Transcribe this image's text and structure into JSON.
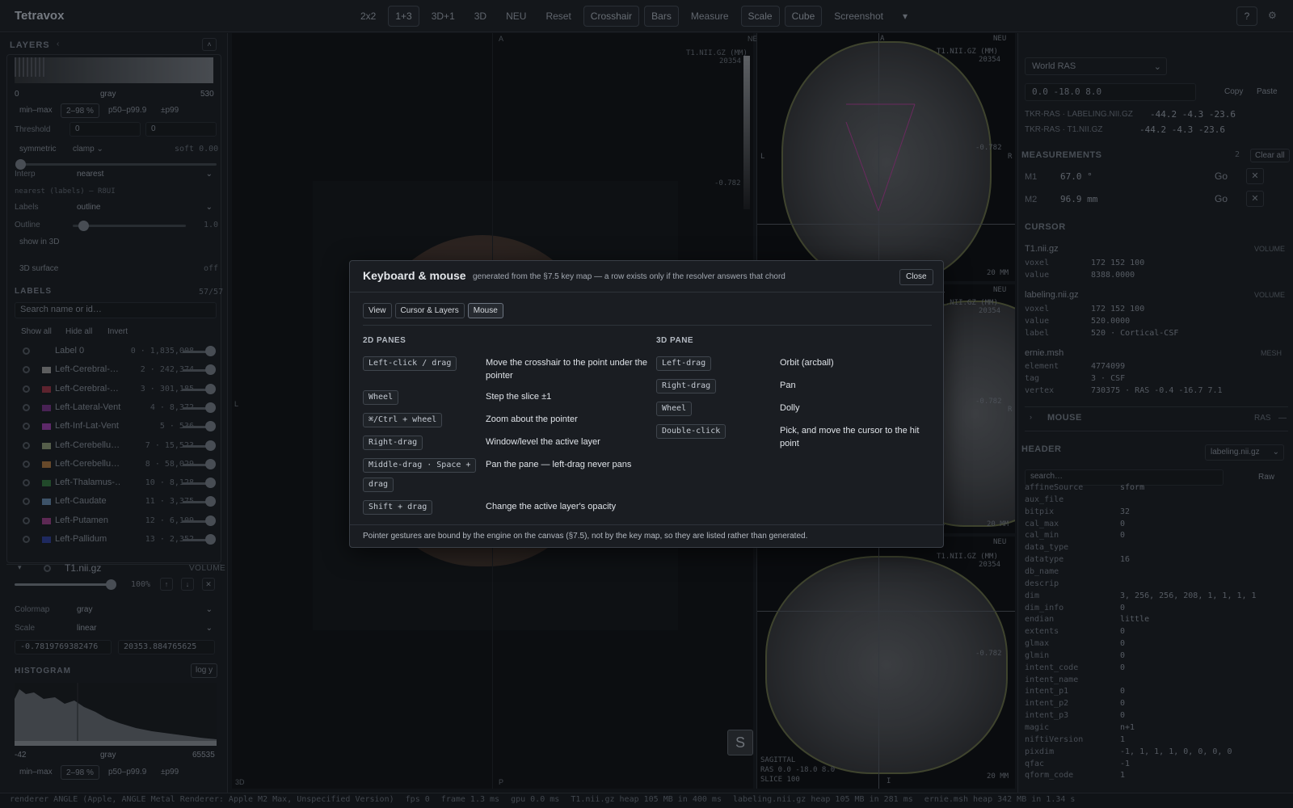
{
  "app": {
    "title": "Tetravox",
    "modes": [
      "2x2",
      "1+3",
      "3D+1",
      "3D",
      "NEU",
      "Reset",
      "Crosshair",
      "Bars",
      "Measure",
      "Scale",
      "Cube",
      "Screenshot"
    ],
    "help": "?"
  },
  "left": {
    "layers_title": "LAYERS",
    "hist_min": "0",
    "hist_cmap": "gray",
    "hist_max": "530",
    "range_chips": [
      "min–max",
      "2–98 %",
      "p50–p99.9",
      "±p99"
    ],
    "threshold_label": "Threshold",
    "threshold_lo": "0",
    "threshold_hi": "0",
    "symmetric": "symmetric",
    "clamp": "clamp",
    "soft": "soft 0.00",
    "interp_label": "Interp",
    "interp_value": "nearest",
    "interp_note": "nearest (labels) — R8UI",
    "labels_label": "Labels",
    "labels_value": "outline",
    "outline_label": "Outline",
    "outline_value": "1.0",
    "show3d": "show in 3D",
    "surface": "3D surface",
    "surface_state": "off",
    "labels_section": "LABELS",
    "labels_count": "57/57",
    "search_placeholder": "Search name or id…",
    "show_all": "Show all",
    "hide_all": "Hide all",
    "invert": "Invert",
    "labels": [
      {
        "name": "Label 0",
        "count": "0 · 1,835,008",
        "color": ""
      },
      {
        "name": "Left-Cerebral-…",
        "count": "2 · 242,374",
        "color": "#8a8a8a"
      },
      {
        "name": "Left-Cerebral-…",
        "count": "3 · 301,185",
        "color": "#8a3040"
      },
      {
        "name": "Left-Lateral-Vent…",
        "count": "4 · 8,372",
        "color": "#6a2e7a"
      },
      {
        "name": "Left-Inf-Lat-Vent",
        "count": "5 · 536",
        "color": "#8a3a9a"
      },
      {
        "name": "Left-Cerebellu…",
        "count": "7 · 15,523",
        "color": "#7f8a6a"
      },
      {
        "name": "Left-Cerebellu…",
        "count": "8 · 58,029",
        "color": "#9a6a3a"
      },
      {
        "name": "Left-Thalamus-…",
        "count": "10 · 8,128",
        "color": "#2e6a3a"
      },
      {
        "name": "Left-Caudate",
        "count": "11 · 3,375",
        "color": "#5a7a9a"
      },
      {
        "name": "Left-Putamen",
        "count": "12 · 6,109",
        "color": "#8a3a7a"
      },
      {
        "name": "Left-Pallidum",
        "count": "13 · 2,352",
        "color": "#2a3a8a"
      }
    ],
    "volume_name": "T1.nii.gz",
    "volume_kind": "VOLUME",
    "opacity": "100%",
    "colormap_label": "Colormap",
    "colormap_value": "gray",
    "scale_label": "Scale",
    "scale_value": "linear",
    "range_lo": "-0.7819769382476",
    "range_hi": "20353.884765625",
    "histogram_title": "HISTOGRAM",
    "log_y": "log y",
    "hist2_min": "-42",
    "hist2_cmap": "gray",
    "hist2_max": "65535",
    "range_chips2": [
      "min–max",
      "2–98 %",
      "p50–p99.9",
      "±p99"
    ]
  },
  "viewports": {
    "main_top": "A",
    "main_left": "L",
    "main_bottom": "P",
    "main_label": "3D",
    "neu": "NEU",
    "file_label": "T1.NII.GZ (MM)",
    "cbar_max": "20354",
    "cbar_min": "-0.782",
    "scale_bar": "20 MM",
    "pane_right": "R",
    "pane_left": "L",
    "pane_bottom": "I",
    "sagittal_label": "SAGITTAL",
    "sagittal_coord": "RAS 0.0 -18.0 8.0",
    "sagittal_slice": "SLICE 100",
    "hover_key": "S"
  },
  "right": {
    "space": "World RAS",
    "coord": "0.0 -18.0 8.0",
    "copy": "Copy",
    "paste": "Paste",
    "tkr1_label": "TKR-RAS · LABELING.NII.GZ",
    "tkr1_value": "-44.2 -4.3 -23.6",
    "tkr2_label": "TKR-RAS · T1.NII.GZ",
    "tkr2_value": "-44.2 -4.3 -23.6",
    "measurements": "MEASUREMENTS",
    "meas_count": "2",
    "clear_all": "Clear all",
    "meas": [
      {
        "id": "M1",
        "value": "67.0 °",
        "go": "Go"
      },
      {
        "id": "M2",
        "value": "96.9 mm",
        "go": "Go"
      }
    ],
    "cursor": "CURSOR",
    "c1_name": "T1.nii.gz",
    "c1_kind": "VOLUME",
    "c1_voxel_k": "voxel",
    "c1_voxel_v": "172 152 100",
    "c1_value_k": "value",
    "c1_value_v": "8388.0000",
    "c2_name": "labeling.nii.gz",
    "c2_kind": "VOLUME",
    "c2_voxel_k": "voxel",
    "c2_voxel_v": "172 152 100",
    "c2_value_k": "value",
    "c2_value_v": "520.0000",
    "c2_label_k": "label",
    "c2_label_v": "520 · Cortical-CSF",
    "c3_name": "ernie.msh",
    "c3_kind": "MESH",
    "c3_el_k": "element",
    "c3_el_v": "4774099",
    "c3_tag_k": "tag",
    "c3_tag_v": "3 · CSF",
    "c3_vx_k": "vertex",
    "c3_vx_v": "730375 · RAS -0.4 -16.7 7.1",
    "mouse": "MOUSE",
    "mouse_space": "RAS",
    "mouse_dash": "—",
    "header": "HEADER",
    "header_file": "labeling.nii.gz",
    "header_search": "search…",
    "raw": "Raw",
    "fields": [
      {
        "k": "affineSource",
        "v": "sform"
      },
      {
        "k": "aux_file",
        "v": ""
      },
      {
        "k": "bitpix",
        "v": "32"
      },
      {
        "k": "cal_max",
        "v": "0"
      },
      {
        "k": "cal_min",
        "v": "0"
      },
      {
        "k": "data_type",
        "v": ""
      },
      {
        "k": "datatype",
        "v": "16"
      },
      {
        "k": "db_name",
        "v": ""
      },
      {
        "k": "descrip",
        "v": ""
      },
      {
        "k": "dim",
        "v": "3, 256, 256, 208, 1, 1, 1, 1"
      },
      {
        "k": "dim_info",
        "v": "0"
      },
      {
        "k": "endian",
        "v": "little"
      },
      {
        "k": "extents",
        "v": "0"
      },
      {
        "k": "glmax",
        "v": "0"
      },
      {
        "k": "glmin",
        "v": "0"
      },
      {
        "k": "intent_code",
        "v": "0"
      },
      {
        "k": "intent_name",
        "v": ""
      },
      {
        "k": "intent_p1",
        "v": "0"
      },
      {
        "k": "intent_p2",
        "v": "0"
      },
      {
        "k": "intent_p3",
        "v": "0"
      },
      {
        "k": "magic",
        "v": "n+1"
      },
      {
        "k": "niftiVersion",
        "v": "1"
      },
      {
        "k": "pixdim",
        "v": "-1, 1, 1, 1, 0, 0, 0, 0"
      },
      {
        "k": "qfac",
        "v": "-1"
      },
      {
        "k": "qform_code",
        "v": "1"
      }
    ]
  },
  "status": {
    "renderer": "renderer ANGLE (Apple, ANGLE Metal Renderer: Apple M2 Max, Unspecified Version)",
    "fps": "fps 0",
    "frame": "frame 1.3 ms",
    "gpu": "gpu 0.0 ms",
    "t1": "T1.nii.gz heap 105 MB in 400 ms",
    "lab": "labeling.nii.gz heap 105 MB in 281 ms",
    "msh": "ernie.msh heap 342 MB in 1.34 s"
  },
  "modal": {
    "title": "Keyboard & mouse",
    "subtitle": "generated from the §7.5 key map — a row exists only if the resolver answers that chord",
    "close": "Close",
    "tabs": [
      "View",
      "Cursor & Layers",
      "Mouse"
    ],
    "col2d": "2D PANES",
    "col3d": "3D PANE",
    "rows2d": [
      {
        "key": "Left-click / drag",
        "desc": "Move the crosshair to the point under the pointer"
      },
      {
        "key": "Wheel",
        "desc": "Step the slice ±1"
      },
      {
        "key": "⌘/Ctrl + wheel",
        "desc": "Zoom about the pointer"
      },
      {
        "key": "Right-drag",
        "desc": "Window/level the active layer"
      },
      {
        "key": "Middle-drag · Space +",
        "key2": "drag",
        "desc": "Pan the pane — left-drag never pans"
      },
      {
        "key": "Shift + drag",
        "desc": "Change the active layer's opacity"
      }
    ],
    "rows3d": [
      {
        "key": "Left-drag",
        "desc": "Orbit (arcball)"
      },
      {
        "key": "Right-drag",
        "desc": "Pan"
      },
      {
        "key": "Wheel",
        "desc": "Dolly"
      },
      {
        "key": "Double-click",
        "desc": "Pick, and move the cursor to the hit point"
      }
    ],
    "footer": "Pointer gestures are bound by the engine on the canvas (§7.5), not by the key map, so they are listed rather than generated."
  }
}
